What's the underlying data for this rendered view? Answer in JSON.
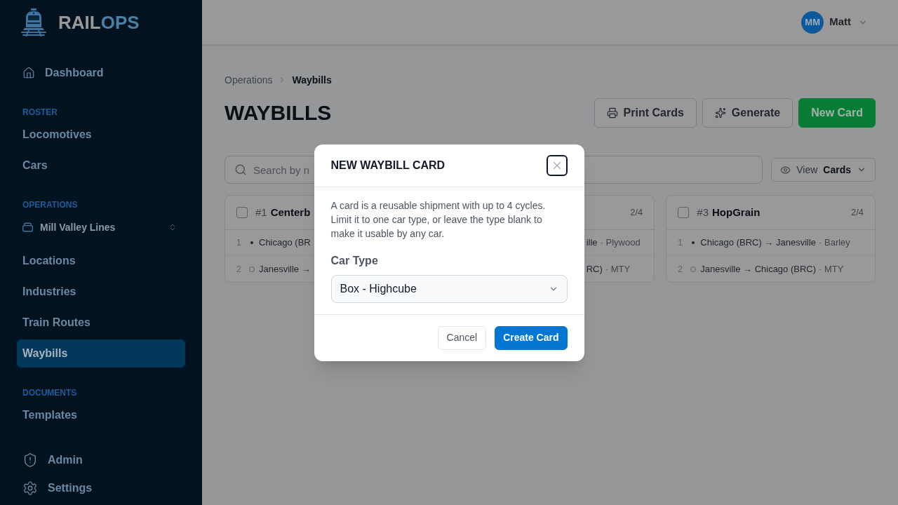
{
  "sidebar": {
    "brand": {
      "main": "RAIL",
      "accent": "OPS"
    },
    "home": {
      "label": "Dashboard",
      "selected": false
    },
    "sections": [
      {
        "title": "ROSTER",
        "items": [
          {
            "label": "Locomotives",
            "selected": false
          },
          {
            "label": "Cars",
            "selected": false
          }
        ]
      },
      {
        "title": "OPERATIONS",
        "picker": {
          "label": "Mill Valley Lines"
        },
        "items": [
          {
            "label": "Locations",
            "selected": false
          },
          {
            "label": "Industries",
            "selected": false
          },
          {
            "label": "Train Routes",
            "selected": false
          },
          {
            "label": "Waybills",
            "selected": true
          }
        ]
      },
      {
        "title": "DOCUMENTS",
        "items": [
          {
            "label": "Templates",
            "selected": false
          }
        ]
      }
    ],
    "footer": [
      {
        "label": "Admin",
        "selected": false
      },
      {
        "label": "Settings",
        "selected": false
      }
    ]
  },
  "header": {
    "user": {
      "initials": "MM",
      "name": "Matt"
    }
  },
  "page": {
    "breadcrumb": [
      {
        "label": "Operations",
        "current": false
      },
      {
        "label": "Waybills",
        "current": true
      }
    ],
    "title": "WAYBILLS",
    "actions": [
      {
        "kind": "outline",
        "label": "Print Cards"
      },
      {
        "kind": "outline",
        "label": "Generate"
      },
      {
        "kind": "primary",
        "label": "New Card"
      }
    ]
  },
  "toolbar": {
    "search": {
      "placeholder": "Search by n"
    },
    "view": {
      "label": "View",
      "value": "Cards"
    }
  },
  "cards": [
    {
      "checked": false,
      "number": "#1",
      "name": "Centerb",
      "rows": [
        {
          "num": "1",
          "loaded": true,
          "route": "Chicago (BR"
        },
        {
          "num": "2",
          "loaded": false,
          "route": "Janesville →"
        }
      ]
    },
    {
      "count": "2/4",
      "rows": [
        {
          "route": "ille",
          "cargo": "· Plywood"
        },
        {
          "route": "RC)",
          "cargo": "· MTY"
        }
      ]
    },
    {
      "checked": false,
      "number": "#3",
      "name": "HopGrain",
      "count": "2/4",
      "rows": [
        {
          "num": "1",
          "loaded": true,
          "route": "Chicago (BRC) → Janesville",
          "cargo": "· Barley"
        },
        {
          "num": "2",
          "loaded": false,
          "route": "Janesville → Chicago (BRC)",
          "cargo": "· MTY"
        }
      ]
    }
  ],
  "modal": {
    "title": "NEW WAYBILL CARD",
    "close": {
      "focused": true
    },
    "description": "A card is a reusable shipment with up to 4 cycles. Limit it to one car type, or leave the type blank to make it usable by any car.",
    "field": {
      "label": "Car Type",
      "value": "Box - Highcube"
    },
    "buttons": [
      {
        "kind": "secondary",
        "label": "Cancel"
      },
      {
        "kind": "primary",
        "label": "Create Card"
      }
    ]
  }
}
